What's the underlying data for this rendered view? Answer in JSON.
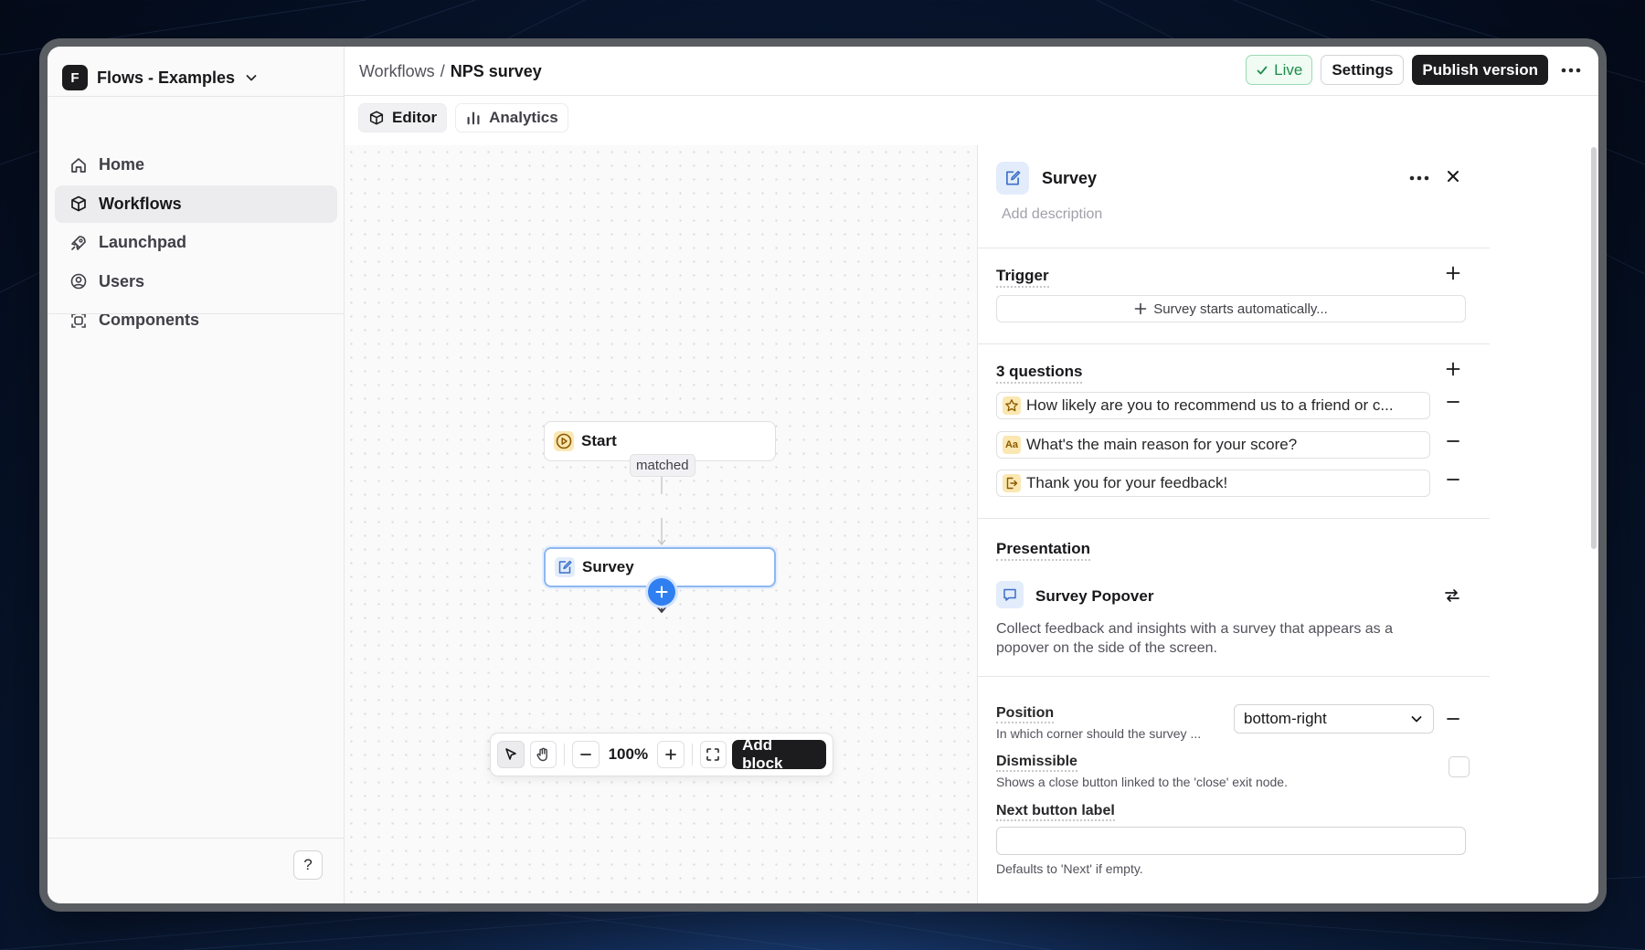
{
  "workspace": {
    "initial": "F",
    "name": "Flows - Examples"
  },
  "sidebar": {
    "items": [
      {
        "label": "Home",
        "icon": "home-icon"
      },
      {
        "label": "Workflows",
        "icon": "cube-icon"
      },
      {
        "label": "Launchpad",
        "icon": "rocket-icon"
      },
      {
        "label": "Users",
        "icon": "user-circle-icon"
      },
      {
        "label": "Components",
        "icon": "component-icon"
      }
    ],
    "active_index": 1,
    "help_label": "?"
  },
  "header": {
    "breadcrumb_parent": "Workflows",
    "breadcrumb_separator": "/",
    "breadcrumb_current": "NPS survey",
    "live_label": "Live",
    "settings_label": "Settings",
    "publish_label": "Publish version"
  },
  "tabs": [
    {
      "label": "Editor",
      "icon": "cube-icon",
      "active": true
    },
    {
      "label": "Analytics",
      "icon": "bar-chart-icon",
      "active": false
    }
  ],
  "canvas": {
    "nodes": [
      {
        "label": "Start",
        "icon": "play-circle-icon"
      },
      {
        "label": "Survey",
        "icon": "survey-edit-icon",
        "selected": true
      }
    ],
    "edge_label": "matched",
    "zoom": "100%",
    "add_block_label": "Add block"
  },
  "panel": {
    "title": "Survey",
    "description_placeholder": "Add description",
    "trigger": {
      "title": "Trigger",
      "placeholder": "Survey starts automatically..."
    },
    "questions": {
      "title": "3 questions",
      "items": [
        {
          "text": "How likely are you to recommend us to a friend or c...",
          "icon": "star-icon"
        },
        {
          "text": "What's the main reason for your score?",
          "icon": "text-aa-icon"
        },
        {
          "text": "Thank you for your feedback!",
          "icon": "exit-icon"
        }
      ]
    },
    "presentation": {
      "title": "Presentation",
      "component": "Survey Popover",
      "description": "Collect feedback and insights with a survey that appears as a popover on the side of the screen."
    },
    "fields": {
      "position": {
        "label": "Position",
        "help": "In which corner should the survey ...",
        "value": "bottom-right"
      },
      "dismissible": {
        "label": "Dismissible",
        "help": "Shows a close button linked to the 'close' exit node.",
        "checked": false
      },
      "next_button": {
        "label": "Next button label",
        "value": "",
        "help": "Defaults to 'Next' if empty."
      }
    }
  },
  "colors": {
    "accent": "#2f7ff0",
    "live": "#1e8c4a",
    "dark": "#1c1c1e"
  }
}
